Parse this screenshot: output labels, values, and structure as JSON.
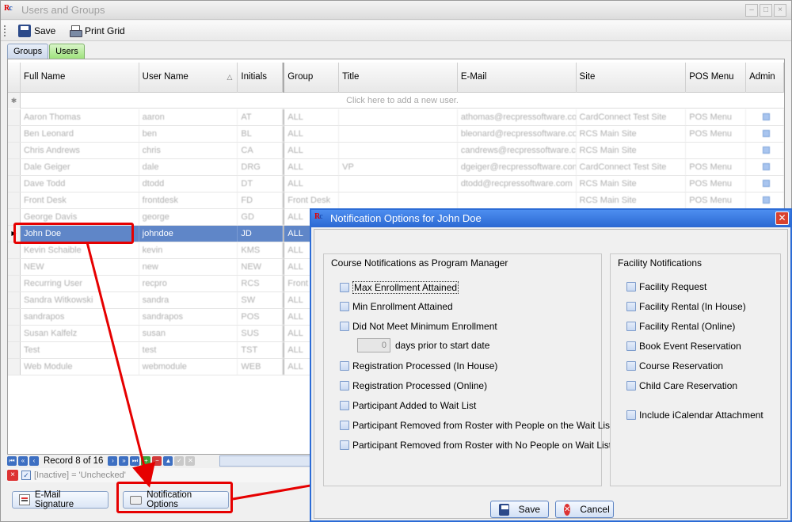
{
  "window": {
    "title": "Users and Groups"
  },
  "toolbar": {
    "save_label": "Save",
    "print_label": "Print Grid"
  },
  "tabs": [
    {
      "label": "Groups"
    },
    {
      "label": "Users"
    }
  ],
  "grid": {
    "columns": [
      "Full Name",
      "User Name",
      "Initials",
      "Group",
      "Title",
      "E-Mail",
      "Site",
      "POS Menu",
      "Admin"
    ],
    "sort_indicator": "△",
    "new_row_text": "Click here to add a new user.",
    "rows": [
      {
        "full_name": "Aaron Thomas",
        "user_name": "aaron",
        "initials": "AT",
        "group": "ALL",
        "title": "",
        "email": "athomas@recpressoftware.com",
        "site": "CardConnect Test Site",
        "pos_menu": "POS Menu",
        "admin": true
      },
      {
        "full_name": "Ben Leonard",
        "user_name": "ben",
        "initials": "BL",
        "group": "ALL",
        "title": "",
        "email": "bleonard@recpressoftware.com",
        "site": "RCS Main Site",
        "pos_menu": "POS Menu",
        "admin": true
      },
      {
        "full_name": "Chris Andrews",
        "user_name": "chris",
        "initials": "CA",
        "group": "ALL",
        "title": "",
        "email": "candrews@recpressoftware.com",
        "site": "RCS Main Site",
        "pos_menu": "",
        "admin": true
      },
      {
        "full_name": "Dale Geiger",
        "user_name": "dale",
        "initials": "DRG",
        "group": "ALL",
        "title": "VP",
        "email": "dgeiger@recpressoftware.com",
        "site": "CardConnect Test Site",
        "pos_menu": "POS Menu",
        "admin": true
      },
      {
        "full_name": "Dave Todd",
        "user_name": "dtodd",
        "initials": "DT",
        "group": "ALL",
        "title": "",
        "email": "dtodd@recpressoftware.com",
        "site": "RCS Main Site",
        "pos_menu": "POS Menu",
        "admin": true
      },
      {
        "full_name": "Front Desk",
        "user_name": "frontdesk",
        "initials": "FD",
        "group": "Front Desk",
        "title": "",
        "email": "",
        "site": "RCS Main Site",
        "pos_menu": "POS Menu",
        "admin": true
      },
      {
        "full_name": "George Davis",
        "user_name": "george",
        "initials": "GD",
        "group": "ALL",
        "title": "",
        "email": "",
        "site": "",
        "pos_menu": "",
        "admin": true
      },
      {
        "full_name": "John Doe",
        "user_name": "johndoe",
        "initials": "JD",
        "group": "ALL",
        "title": "",
        "email": "",
        "site": "",
        "pos_menu": "",
        "admin": false,
        "selected": true
      },
      {
        "full_name": "Kevin Schaible",
        "user_name": "kevin",
        "initials": "KMS",
        "group": "ALL",
        "title": "",
        "email": "",
        "site": "",
        "pos_menu": "",
        "admin": false
      },
      {
        "full_name": "NEW",
        "user_name": "new",
        "initials": "NEW",
        "group": "ALL",
        "title": "",
        "email": "",
        "site": "",
        "pos_menu": "",
        "admin": false
      },
      {
        "full_name": "Recurring User",
        "user_name": "recpro",
        "initials": "RCS",
        "group": "Front Desk",
        "title": "",
        "email": "",
        "site": "",
        "pos_menu": "",
        "admin": false
      },
      {
        "full_name": "Sandra Witkowski",
        "user_name": "sandra",
        "initials": "SW",
        "group": "ALL",
        "title": "",
        "email": "",
        "site": "",
        "pos_menu": "",
        "admin": false
      },
      {
        "full_name": "sandrapos",
        "user_name": "sandrapos",
        "initials": "POS",
        "group": "ALL",
        "title": "",
        "email": "",
        "site": "",
        "pos_menu": "",
        "admin": false
      },
      {
        "full_name": "Susan Kalfelz",
        "user_name": "susan",
        "initials": "SUS",
        "group": "ALL",
        "title": "",
        "email": "",
        "site": "",
        "pos_menu": "",
        "admin": false
      },
      {
        "full_name": "Test",
        "user_name": "test",
        "initials": "TST",
        "group": "ALL",
        "title": "",
        "email": "",
        "site": "",
        "pos_menu": "",
        "admin": false
      },
      {
        "full_name": "Web Module",
        "user_name": "webmodule",
        "initials": "WEB",
        "group": "ALL",
        "title": "",
        "email": "",
        "site": "",
        "pos_menu": "",
        "admin": false
      }
    ]
  },
  "navigator": {
    "record_text": "Record 8 of 16"
  },
  "filter": {
    "text": "[Inactive] = 'Unchecked'"
  },
  "bottom_buttons": {
    "email_signature": "E-Mail Signature",
    "notification_options": "Notification Options"
  },
  "dialog": {
    "title": "Notification Options for John Doe",
    "course_group": {
      "title": "Course Notifications as Program Manager",
      "options": [
        "Max Enrollment Attained",
        "Min Enrollment Attained",
        "Did Not Meet Minimum Enrollment",
        "Registration Processed (In House)",
        "Registration Processed (Online)",
        "Participant Added to Wait List",
        "Participant Removed from Roster with People on the Wait List",
        "Participant Removed from Roster with No People on Wait List"
      ],
      "days_value": "0",
      "days_label": "days prior to start date"
    },
    "facility_group": {
      "title": "Facility Notifications",
      "options": [
        "Facility Request",
        "Facility Rental (In House)",
        "Facility Rental (Online)",
        "Book Event Reservation",
        "Course Reservation",
        "Child Care Reservation"
      ],
      "ical_label": "Include iCalendar Attachment"
    },
    "save_label": "Save",
    "cancel_label": "Cancel"
  },
  "colors": {
    "annotation": "#e60000",
    "selected_row": "#5f86c8",
    "dialog_titlebar": "#2b68d2"
  }
}
